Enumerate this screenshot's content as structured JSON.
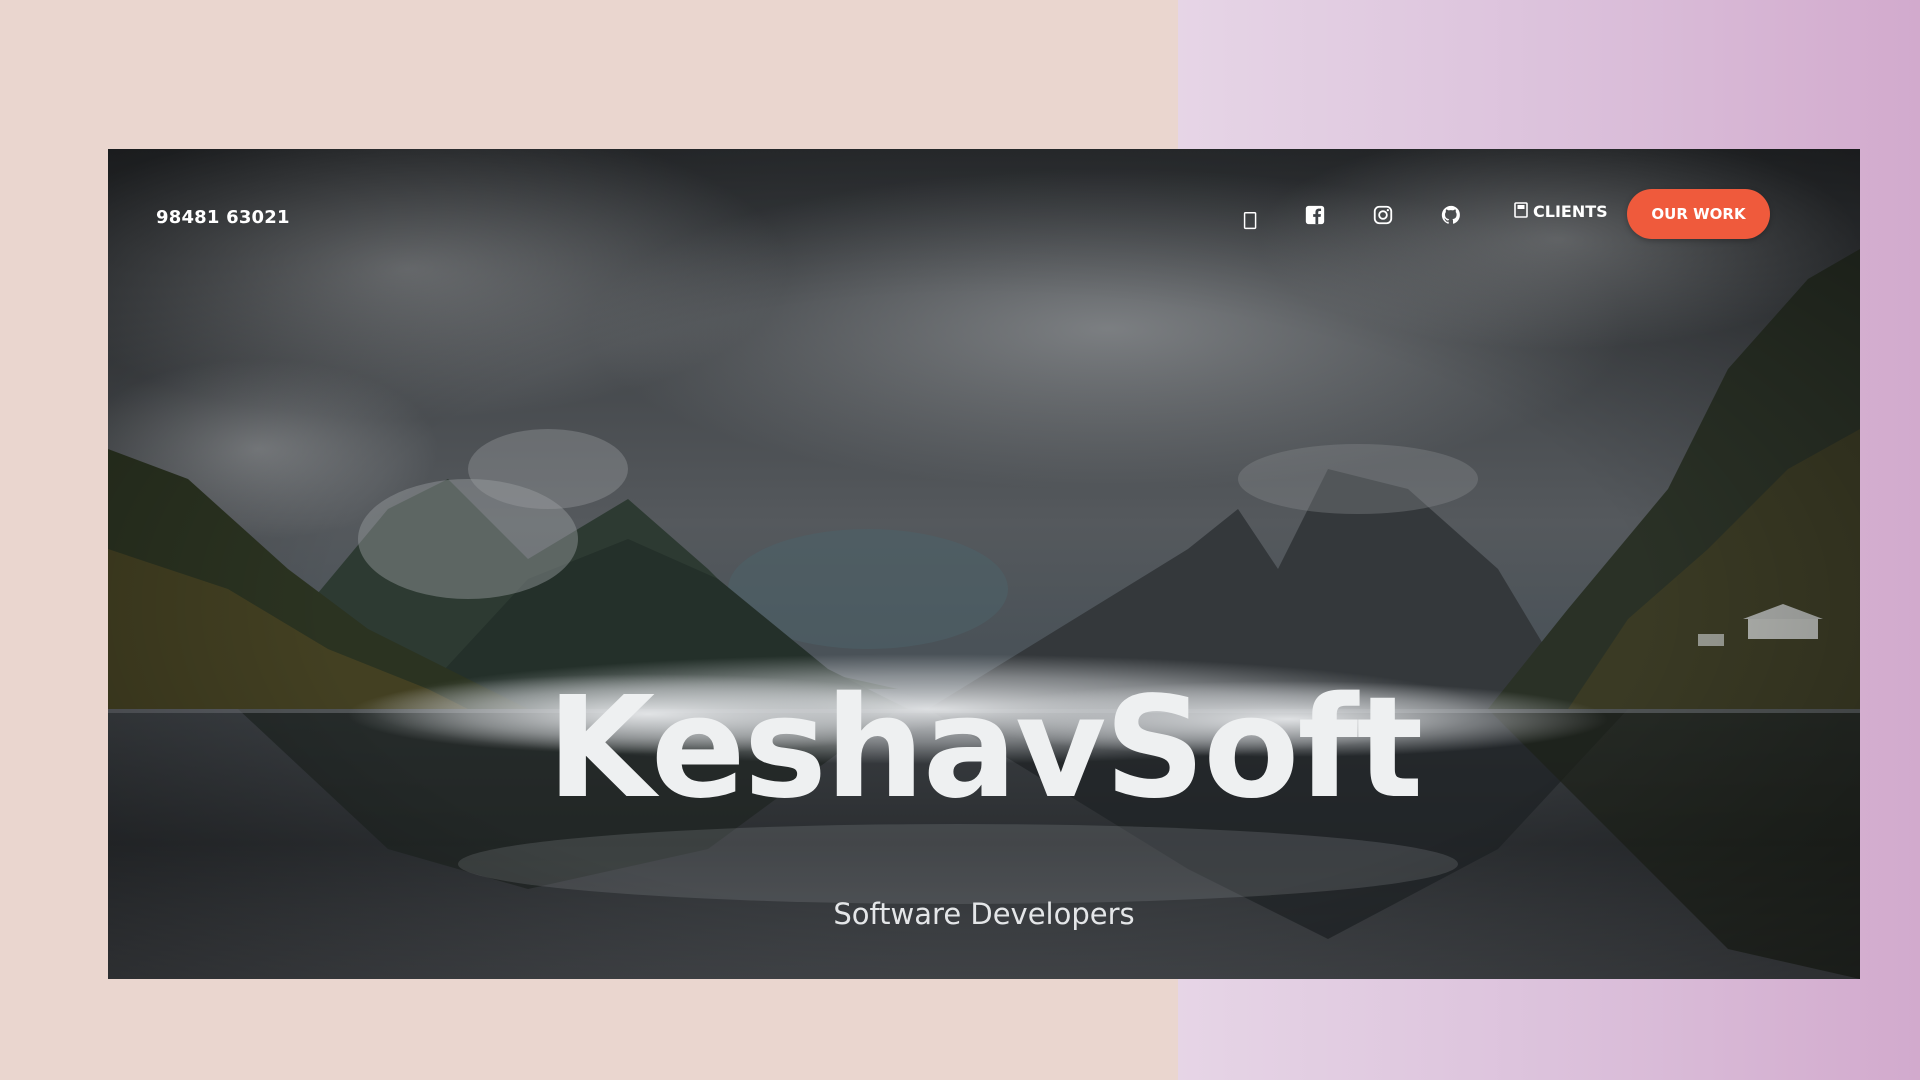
{
  "header": {
    "phone": "98481 63021",
    "clients_label": "CLIENTS",
    "cta_label": "OUR WORK"
  },
  "social_icons": [
    "phone-icon",
    "facebook-icon",
    "instagram-icon",
    "github-icon"
  ],
  "hero": {
    "title": "KeshavSoft",
    "subtitle": "Software Developers"
  },
  "colors": {
    "accent": "#ef5a3c",
    "backdrop_left": "#ead6cf",
    "backdrop_right": "#d8b6d6",
    "text": "#ffffff"
  }
}
